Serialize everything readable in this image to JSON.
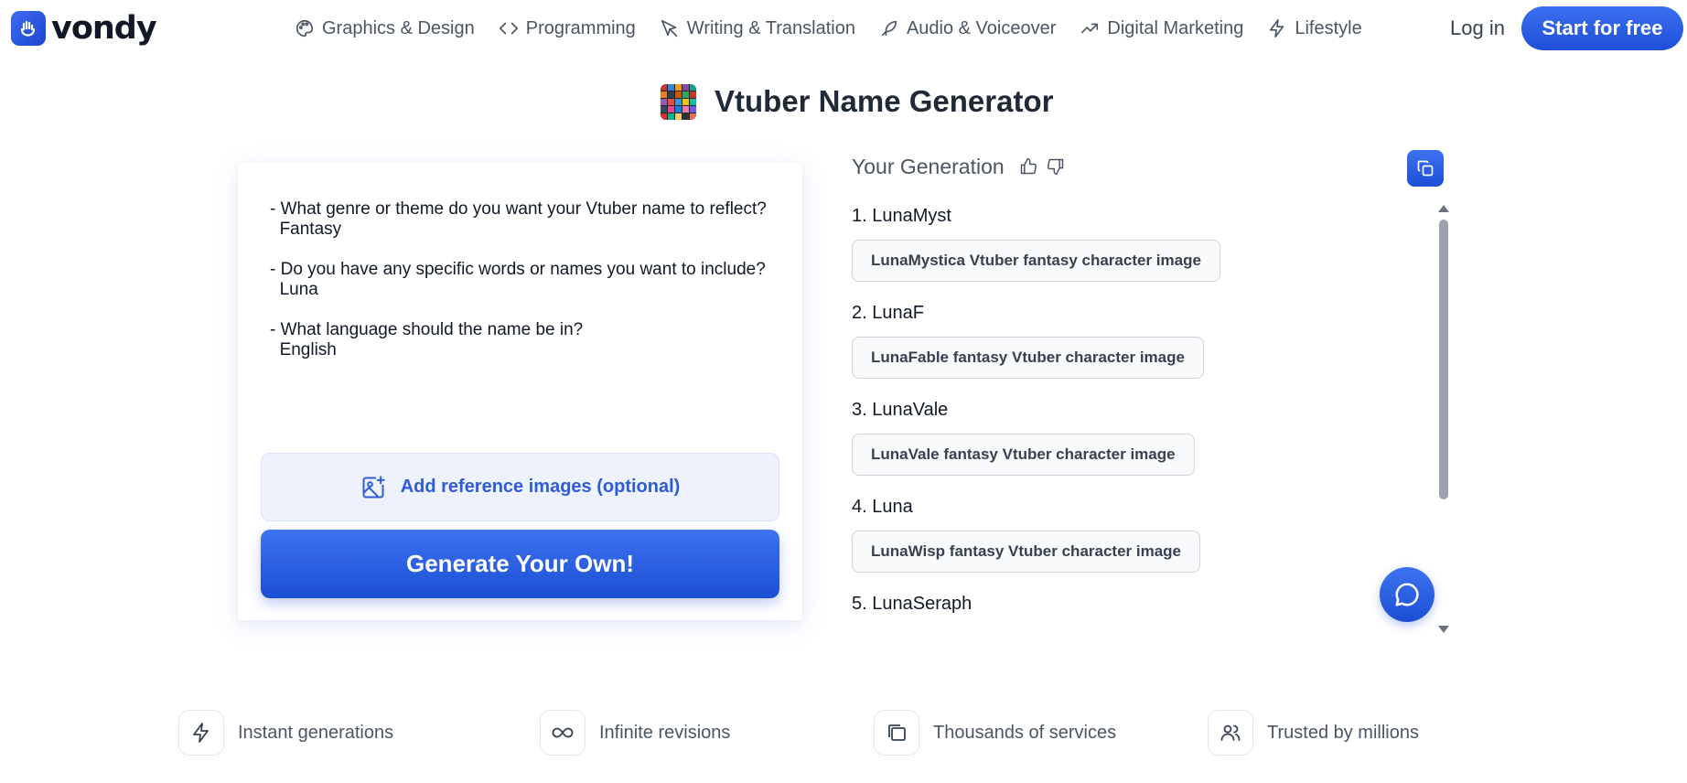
{
  "brand": {
    "name": "vondy"
  },
  "nav": {
    "items": [
      {
        "label": "Graphics & Design",
        "icon": "palette-icon"
      },
      {
        "label": "Programming",
        "icon": "code-icon"
      },
      {
        "label": "Writing & Translation",
        "icon": "pen-nib-icon"
      },
      {
        "label": "Audio & Voiceover",
        "icon": "feather-icon"
      },
      {
        "label": "Digital Marketing",
        "icon": "trend-up-icon"
      },
      {
        "label": "Lifestyle",
        "icon": "bolt-icon"
      }
    ],
    "login_label": "Log in",
    "cta_label": "Start for free"
  },
  "page": {
    "title": "Vtuber Name Generator"
  },
  "form": {
    "prompt_text": "- What genre or theme do you want your Vtuber name to reflect?\n  Fantasy\n\n- Do you have any specific words or names you want to include?\n  Luna\n\n- What language should the name be in?\n  English",
    "reference_label": "Add reference images (optional)",
    "generate_label": "Generate Your Own!"
  },
  "output": {
    "title": "Your Generation",
    "results": [
      {
        "name": "1. LunaMyst",
        "image_button": "LunaMystica Vtuber fantasy character image"
      },
      {
        "name": "2. LunaF",
        "image_button": "LunaFable fantasy Vtuber character image"
      },
      {
        "name": "3. LunaVale",
        "image_button": "LunaVale fantasy Vtuber character image"
      },
      {
        "name": "4. Luna",
        "image_button": "LunaWisp fantasy Vtuber character image"
      },
      {
        "name": "5. LunaSeraph",
        "image_button": ""
      }
    ]
  },
  "features": [
    {
      "label": "Instant generations",
      "icon": "bolt-icon"
    },
    {
      "label": "Infinite revisions",
      "icon": "infinity-icon"
    },
    {
      "label": "Thousands of services",
      "icon": "copies-icon"
    },
    {
      "label": "Trusted by millions",
      "icon": "users-icon"
    }
  ],
  "colors": {
    "accent": "#2356dc",
    "accent_light": "#edf2fd",
    "text": "#1f2937"
  }
}
